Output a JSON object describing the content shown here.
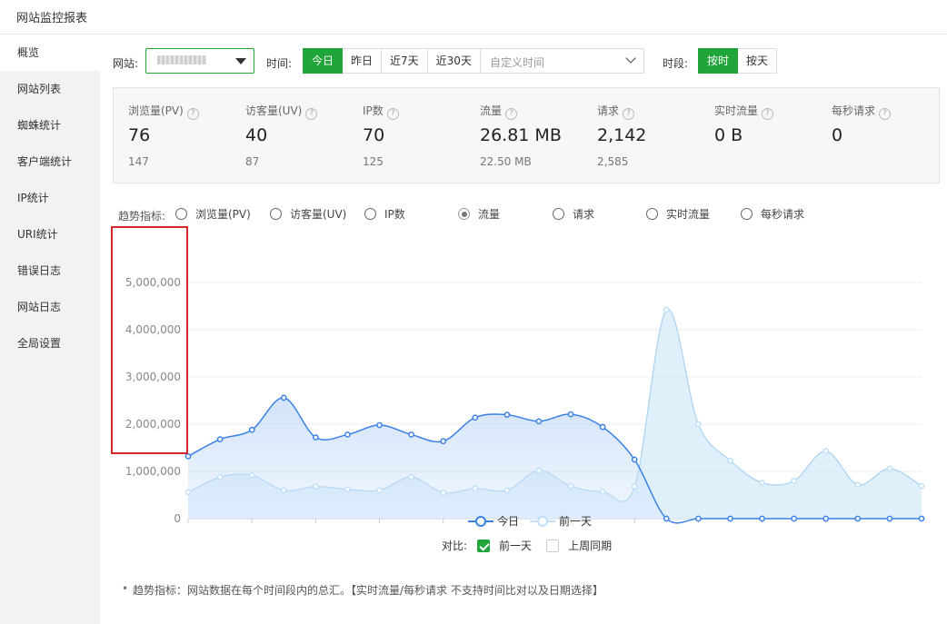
{
  "window_title": "网站监控报表",
  "sidebar": {
    "items": [
      {
        "label": "概览",
        "active": true
      },
      {
        "label": "网站列表"
      },
      {
        "label": "蜘蛛统计"
      },
      {
        "label": "客户端统计"
      },
      {
        "label": "IP统计"
      },
      {
        "label": "URI统计"
      },
      {
        "label": "错误日志"
      },
      {
        "label": "网站日志"
      },
      {
        "label": "全局设置"
      }
    ]
  },
  "filters": {
    "site_label": "网站:",
    "time_label": "时间:",
    "time_options": [
      "今日",
      "昨日",
      "近7天",
      "近30天"
    ],
    "time_selected": "今日",
    "custom_time_placeholder": "自定义时间",
    "period_label": "时段:",
    "period_options": [
      "按时",
      "按天"
    ],
    "period_selected": "按时"
  },
  "stats": [
    {
      "name": "浏览量(PV)",
      "value": "76",
      "prev": "147"
    },
    {
      "name": "访客量(UV)",
      "value": "40",
      "prev": "87"
    },
    {
      "name": "IP数",
      "value": "70",
      "prev": "125"
    },
    {
      "name": "流量",
      "value": "26.81 MB",
      "prev": "22.50 MB"
    },
    {
      "name": "请求",
      "value": "2,142",
      "prev": "2,585"
    },
    {
      "name": "实时流量",
      "value": "0 B",
      "prev": ""
    },
    {
      "name": "每秒请求",
      "value": "0",
      "prev": ""
    }
  ],
  "trend": {
    "label": "趋势指标:",
    "options": [
      "浏览量(PV)",
      "访客量(UV)",
      "IP数",
      "流量",
      "请求",
      "实时流量",
      "每秒请求"
    ],
    "selected": "流量"
  },
  "legend": {
    "today": "今日",
    "previous": "前一天"
  },
  "compare": {
    "label": "对比:",
    "options": [
      {
        "label": "前一天",
        "checked": true
      },
      {
        "label": "上周同期",
        "checked": false
      }
    ]
  },
  "note": "趋势指标：网站数据在每个时间段内的总汇。【实时流量/每秒请求 不支持时间比对以及日期选择】",
  "colors": {
    "accent": "#20a53a",
    "today": "#3b82e6",
    "previous": "#bfe0f7",
    "highlight": "#d62728"
  },
  "chart_data": {
    "type": "area",
    "x": [
      0,
      1,
      2,
      3,
      4,
      5,
      6,
      7,
      8,
      9,
      10,
      11,
      12,
      13,
      14,
      15,
      16,
      17,
      18,
      19,
      20,
      21,
      22,
      23
    ],
    "series": [
      {
        "name": "今日",
        "values": [
          1320000,
          1680000,
          1880000,
          2560000,
          1720000,
          1780000,
          1980000,
          1780000,
          1640000,
          2140000,
          2200000,
          2060000,
          2210000,
          1940000,
          1250000,
          0,
          0,
          0,
          0,
          0,
          0,
          0,
          0,
          0
        ]
      },
      {
        "name": "前一天",
        "values": [
          560000,
          880000,
          920000,
          600000,
          680000,
          620000,
          600000,
          880000,
          550000,
          640000,
          600000,
          1020000,
          690000,
          570000,
          680000,
          4420000,
          2000000,
          1230000,
          760000,
          800000,
          1430000,
          720000,
          1060000,
          690000
        ]
      }
    ],
    "xticks": [
      0,
      2,
      4,
      6,
      8,
      10,
      12,
      14,
      16,
      18,
      20,
      22
    ],
    "yticks": [
      "0",
      "1,000,000",
      "2,000,000",
      "3,000,000",
      "4,000,000",
      "5,000,000"
    ],
    "ylim": [
      0,
      5000000
    ],
    "grid": true,
    "legend_position": "bottom"
  }
}
